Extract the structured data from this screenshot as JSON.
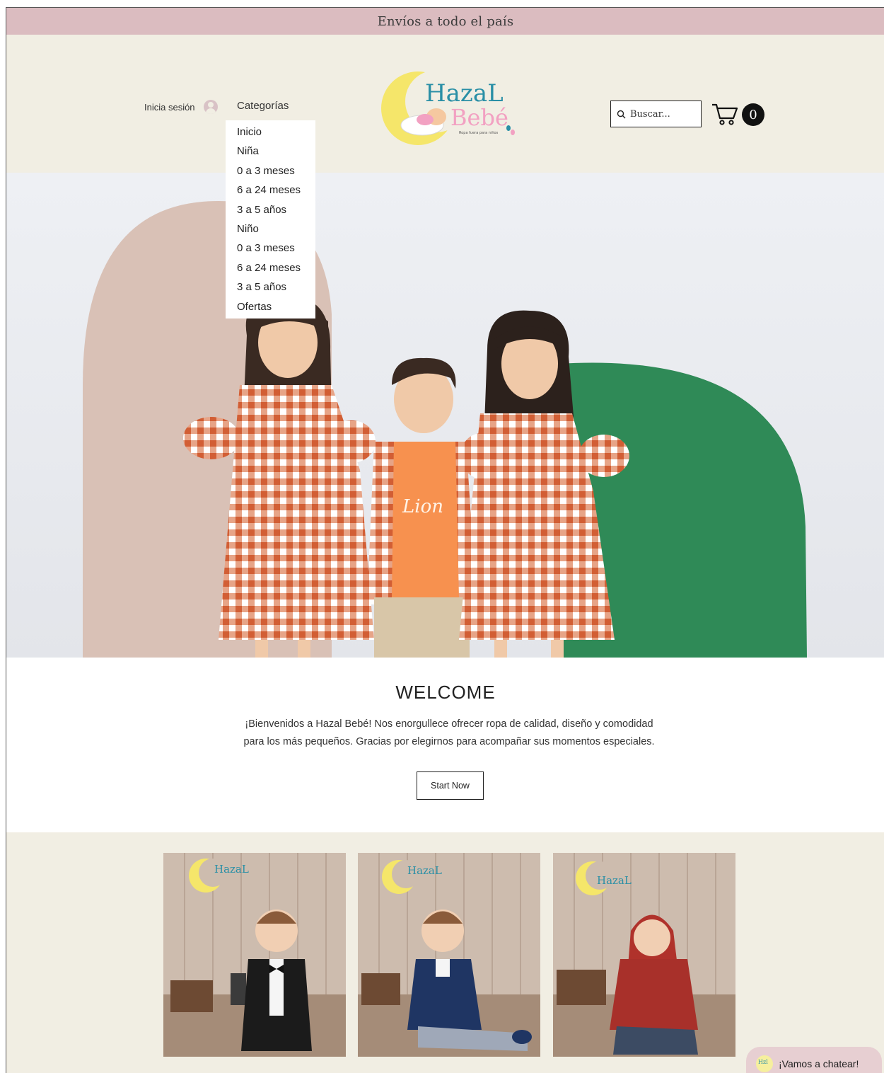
{
  "announcement": "Envíos a todo el país",
  "header": {
    "login_label": "Inicia sesión",
    "categories_label": "Categorías",
    "logo": {
      "line1": "HazaL",
      "line2": "Bebé",
      "tagline": "Ropa fuera para niños"
    },
    "search_placeholder": "Buscar...",
    "cart_count": "0"
  },
  "menu": {
    "items": [
      {
        "label": "Inicio"
      },
      {
        "label": "Niña"
      },
      {
        "label": "0 a 3 meses"
      },
      {
        "label": "6 a 24 meses"
      },
      {
        "label": "3 a 5 años"
      },
      {
        "label": "Niño"
      },
      {
        "label": "0 a 3 meses"
      },
      {
        "label": "6 a 24 meses"
      },
      {
        "label": "3 a 5 años"
      },
      {
        "label": "Ofertas"
      }
    ]
  },
  "hero": {
    "shirt_text": "Lion"
  },
  "welcome": {
    "title": "WELCOME",
    "text_line1": "¡Bienvenidos a Hazal Bebé! Nos enorgullece ofrecer ropa de calidad, diseño y comodidad",
    "text_line2": "para los más pequeños. Gracias por elegirnos para acompañar sus momentos especiales.",
    "button_label": "Start Now"
  },
  "products": {
    "items": [
      {
        "outfit": "black-tuxedo"
      },
      {
        "outfit": "navy-blazer"
      },
      {
        "outfit": "red-knit-hood"
      }
    ]
  },
  "chat": {
    "label": "¡Vamos a chatear!"
  },
  "colors": {
    "announce_bg": "#dbbcc0",
    "header_bg": "#f1eee3",
    "logo_teal": "#2a8fa6",
    "logo_pink": "#f2a1c2",
    "logo_moon": "#f5e66a",
    "gingham": "#d9683f",
    "green_arch": "#2f8a57",
    "pink_arch": "#d9c1b6"
  }
}
